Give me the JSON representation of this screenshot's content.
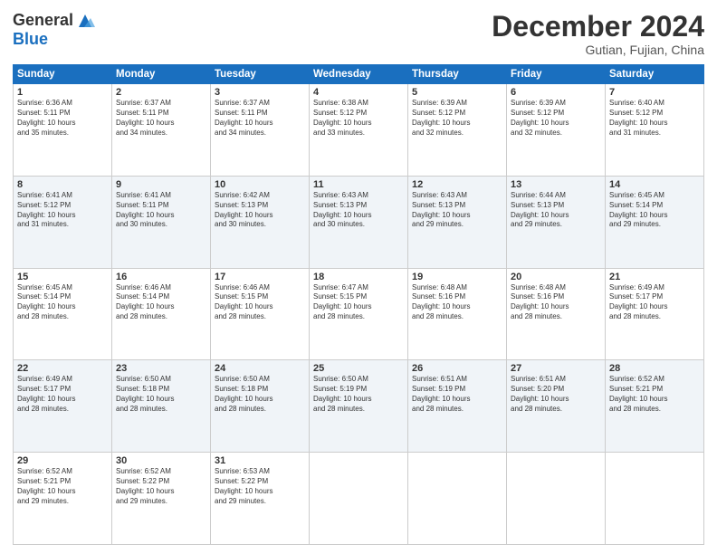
{
  "logo": {
    "general": "General",
    "blue": "Blue"
  },
  "header": {
    "month": "December 2024",
    "location": "Gutian, Fujian, China"
  },
  "weekdays": [
    "Sunday",
    "Monday",
    "Tuesday",
    "Wednesday",
    "Thursday",
    "Friday",
    "Saturday"
  ],
  "weeks": [
    [
      {
        "day": "1",
        "info": "Sunrise: 6:36 AM\nSunset: 5:11 PM\nDaylight: 10 hours\nand 35 minutes."
      },
      {
        "day": "2",
        "info": "Sunrise: 6:37 AM\nSunset: 5:11 PM\nDaylight: 10 hours\nand 34 minutes."
      },
      {
        "day": "3",
        "info": "Sunrise: 6:37 AM\nSunset: 5:11 PM\nDaylight: 10 hours\nand 34 minutes."
      },
      {
        "day": "4",
        "info": "Sunrise: 6:38 AM\nSunset: 5:12 PM\nDaylight: 10 hours\nand 33 minutes."
      },
      {
        "day": "5",
        "info": "Sunrise: 6:39 AM\nSunset: 5:12 PM\nDaylight: 10 hours\nand 32 minutes."
      },
      {
        "day": "6",
        "info": "Sunrise: 6:39 AM\nSunset: 5:12 PM\nDaylight: 10 hours\nand 32 minutes."
      },
      {
        "day": "7",
        "info": "Sunrise: 6:40 AM\nSunset: 5:12 PM\nDaylight: 10 hours\nand 31 minutes."
      }
    ],
    [
      {
        "day": "8",
        "info": "Sunrise: 6:41 AM\nSunset: 5:12 PM\nDaylight: 10 hours\nand 31 minutes."
      },
      {
        "day": "9",
        "info": "Sunrise: 6:41 AM\nSunset: 5:11 PM\nDaylight: 10 hours\nand 30 minutes."
      },
      {
        "day": "10",
        "info": "Sunrise: 6:42 AM\nSunset: 5:13 PM\nDaylight: 10 hours\nand 30 minutes."
      },
      {
        "day": "11",
        "info": "Sunrise: 6:43 AM\nSunset: 5:13 PM\nDaylight: 10 hours\nand 30 minutes."
      },
      {
        "day": "12",
        "info": "Sunrise: 6:43 AM\nSunset: 5:13 PM\nDaylight: 10 hours\nand 29 minutes."
      },
      {
        "day": "13",
        "info": "Sunrise: 6:44 AM\nSunset: 5:13 PM\nDaylight: 10 hours\nand 29 minutes."
      },
      {
        "day": "14",
        "info": "Sunrise: 6:45 AM\nSunset: 5:14 PM\nDaylight: 10 hours\nand 29 minutes."
      }
    ],
    [
      {
        "day": "15",
        "info": "Sunrise: 6:45 AM\nSunset: 5:14 PM\nDaylight: 10 hours\nand 28 minutes."
      },
      {
        "day": "16",
        "info": "Sunrise: 6:46 AM\nSunset: 5:14 PM\nDaylight: 10 hours\nand 28 minutes."
      },
      {
        "day": "17",
        "info": "Sunrise: 6:46 AM\nSunset: 5:15 PM\nDaylight: 10 hours\nand 28 minutes."
      },
      {
        "day": "18",
        "info": "Sunrise: 6:47 AM\nSunset: 5:15 PM\nDaylight: 10 hours\nand 28 minutes."
      },
      {
        "day": "19",
        "info": "Sunrise: 6:48 AM\nSunset: 5:16 PM\nDaylight: 10 hours\nand 28 minutes."
      },
      {
        "day": "20",
        "info": "Sunrise: 6:48 AM\nSunset: 5:16 PM\nDaylight: 10 hours\nand 28 minutes."
      },
      {
        "day": "21",
        "info": "Sunrise: 6:49 AM\nSunset: 5:17 PM\nDaylight: 10 hours\nand 28 minutes."
      }
    ],
    [
      {
        "day": "22",
        "info": "Sunrise: 6:49 AM\nSunset: 5:17 PM\nDaylight: 10 hours\nand 28 minutes."
      },
      {
        "day": "23",
        "info": "Sunrise: 6:50 AM\nSunset: 5:18 PM\nDaylight: 10 hours\nand 28 minutes."
      },
      {
        "day": "24",
        "info": "Sunrise: 6:50 AM\nSunset: 5:18 PM\nDaylight: 10 hours\nand 28 minutes."
      },
      {
        "day": "25",
        "info": "Sunrise: 6:50 AM\nSunset: 5:19 PM\nDaylight: 10 hours\nand 28 minutes."
      },
      {
        "day": "26",
        "info": "Sunrise: 6:51 AM\nSunset: 5:19 PM\nDaylight: 10 hours\nand 28 minutes."
      },
      {
        "day": "27",
        "info": "Sunrise: 6:51 AM\nSunset: 5:20 PM\nDaylight: 10 hours\nand 28 minutes."
      },
      {
        "day": "28",
        "info": "Sunrise: 6:52 AM\nSunset: 5:21 PM\nDaylight: 10 hours\nand 28 minutes."
      }
    ],
    [
      {
        "day": "29",
        "info": "Sunrise: 6:52 AM\nSunset: 5:21 PM\nDaylight: 10 hours\nand 29 minutes."
      },
      {
        "day": "30",
        "info": "Sunrise: 6:52 AM\nSunset: 5:22 PM\nDaylight: 10 hours\nand 29 minutes."
      },
      {
        "day": "31",
        "info": "Sunrise: 6:53 AM\nSunset: 5:22 PM\nDaylight: 10 hours\nand 29 minutes."
      },
      {
        "day": "",
        "info": ""
      },
      {
        "day": "",
        "info": ""
      },
      {
        "day": "",
        "info": ""
      },
      {
        "day": "",
        "info": ""
      }
    ]
  ]
}
